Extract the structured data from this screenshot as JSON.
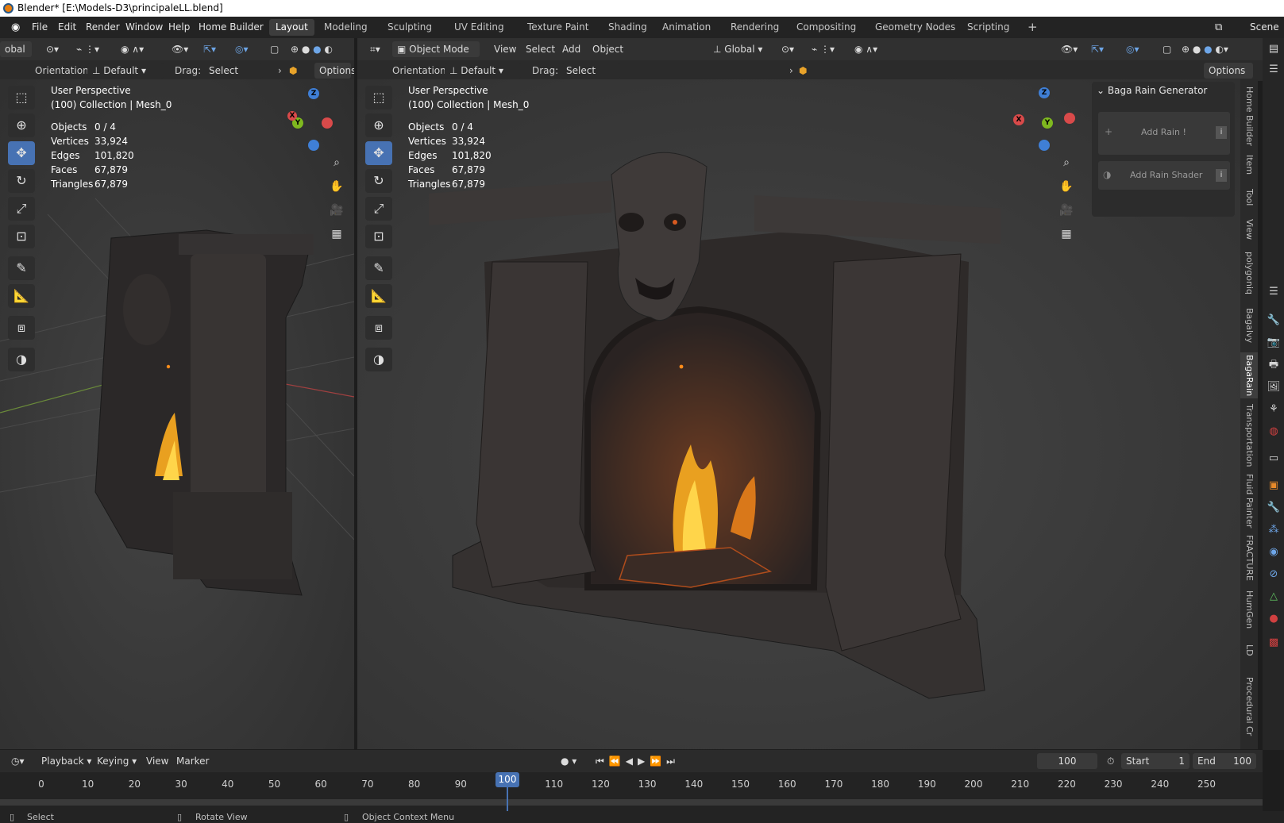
{
  "title_bar": {
    "text": "Blender* [E:\\Models-D3\\principaleLL.blend]"
  },
  "menu": {
    "items": [
      "File",
      "Edit",
      "Render",
      "Window",
      "Help",
      "Home Builder"
    ]
  },
  "workspaces": {
    "tabs": [
      "Layout",
      "Modeling",
      "Sculpting",
      "UV Editing",
      "Texture Paint",
      "Shading",
      "Animation",
      "Rendering",
      "Compositing",
      "Geometry Nodes",
      "Scripting"
    ],
    "active": "Layout",
    "add": "+"
  },
  "scene": {
    "label": "Scene"
  },
  "left_view": {
    "global_partial": "obal",
    "orientation_label": "Orientation:",
    "orientation_value": "Default",
    "drag_label": "Drag:",
    "drag_value": "Select Box",
    "options": "Options",
    "perspective": "User Perspective",
    "collection": "(100) Collection | Mesh_0",
    "stats": {
      "objects_k": "Objects",
      "objects_v": "0 / 4",
      "vertices_k": "Vertices",
      "vertices_v": "33,924",
      "edges_k": "Edges",
      "edges_v": "101,820",
      "faces_k": "Faces",
      "faces_v": "67,879",
      "triangles_k": "Triangles",
      "triangles_v": "67,879"
    }
  },
  "main_view": {
    "mode": "Object Mode",
    "view": "View",
    "select": "Select",
    "add": "Add",
    "object": "Object",
    "transform": "Global",
    "orientation_label": "Orientation:",
    "orientation_value": "Default",
    "drag_label": "Drag:",
    "drag_value": "Select Box",
    "options": "Options",
    "perspective": "User Perspective",
    "collection": "(100) Collection | Mesh_0",
    "stats": {
      "objects_k": "Objects",
      "objects_v": "0 / 4",
      "vertices_k": "Vertices",
      "vertices_v": "33,924",
      "edges_k": "Edges",
      "edges_v": "101,820",
      "faces_k": "Faces",
      "faces_v": "67,879",
      "triangles_k": "Triangles",
      "triangles_v": "67,879"
    }
  },
  "gizmo": {
    "z": "Z",
    "y": "Y",
    "x": "X"
  },
  "n_panel": {
    "title": "Baga Rain Generator",
    "add_rain": "Add Rain !",
    "add_rain_shader": "Add Rain Shader"
  },
  "side_tabs": [
    "Home Builder",
    "Item",
    "Tool",
    "View",
    "polygoniq",
    "Bagalvy",
    "BagaRain",
    "Transportation",
    "Fluid Painter",
    "FRACTURE",
    "HumGen",
    "LD",
    "Procedural Cr"
  ],
  "side_tab_active": "BagaRain",
  "timeline": {
    "playback": "Playback",
    "keying": "Keying",
    "view": "View",
    "marker": "Marker",
    "current_frame": "100",
    "start_label": "Start",
    "start_value": "1",
    "end_label": "End",
    "end_value": "100",
    "ticks": [
      "0",
      "10",
      "20",
      "30",
      "40",
      "50",
      "60",
      "70",
      "80",
      "90",
      "100",
      "110",
      "120",
      "130",
      "140",
      "150",
      "160",
      "170",
      "180",
      "190",
      "200",
      "210",
      "220",
      "230",
      "240",
      "250"
    ],
    "current_tick": "100"
  },
  "status": {
    "select": "Select",
    "rotate": "Rotate View",
    "context": "Object Context Menu"
  },
  "colors": {
    "accent": "#4772b3",
    "x_axis": "#d94a4a",
    "y_axis": "#7fb91f",
    "z_axis": "#3f7fd6"
  }
}
